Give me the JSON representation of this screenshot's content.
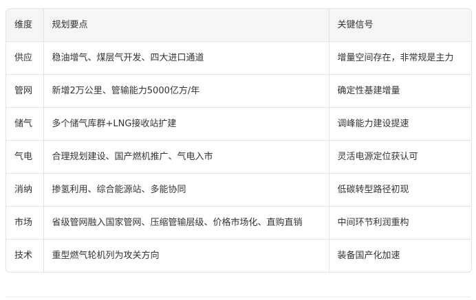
{
  "table": {
    "headers": [
      "维度",
      "规划要点",
      "关键信号"
    ],
    "rows": [
      [
        "供应",
        "稳油增气、煤层气开发、四大进口通道",
        "增量空间存在，非常规是主力"
      ],
      [
        "管网",
        "新增2万公里、管输能力5000亿方/年",
        "确定性基建增量"
      ],
      [
        "储气",
        "多个储气库群+LNG接收站扩建",
        "调峰能力建设提速"
      ],
      [
        "气电",
        "合理规划建设、国产燃机推广、气电入市",
        "灵活电源定位获认可"
      ],
      [
        "消纳",
        "掺氢利用、综合能源站、多能协同",
        "低碳转型路径初现"
      ],
      [
        "市场",
        "省级管网融入国家管网、压缩管输层级、价格市场化、直购直销",
        "中间环节利润重构"
      ],
      [
        "技术",
        "重型燃气轮机列为攻关方向",
        "装备国产化加速"
      ]
    ]
  }
}
